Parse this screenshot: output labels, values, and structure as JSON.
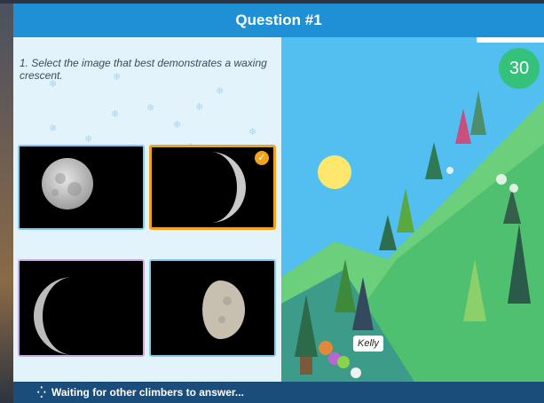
{
  "header": {
    "title": "Question #1"
  },
  "question": {
    "text": "1. Select the image that best demonstrates a waxing crescent."
  },
  "options": [
    {
      "label": "full-moon",
      "selected": false
    },
    {
      "label": "waxing-crescent-right-lit",
      "selected": true
    },
    {
      "label": "waning-crescent-left-lit",
      "selected": false
    },
    {
      "label": "gibbous-moon",
      "selected": false
    }
  ],
  "timer": {
    "value": "30"
  },
  "player": {
    "name": "Kelly"
  },
  "footer": {
    "status": "Waiting for other climbers to answer..."
  },
  "colors": {
    "header": "#1f8fd6",
    "footer": "#1b4d7a",
    "selected": "#f2a21e",
    "timer": "#34c27a"
  }
}
